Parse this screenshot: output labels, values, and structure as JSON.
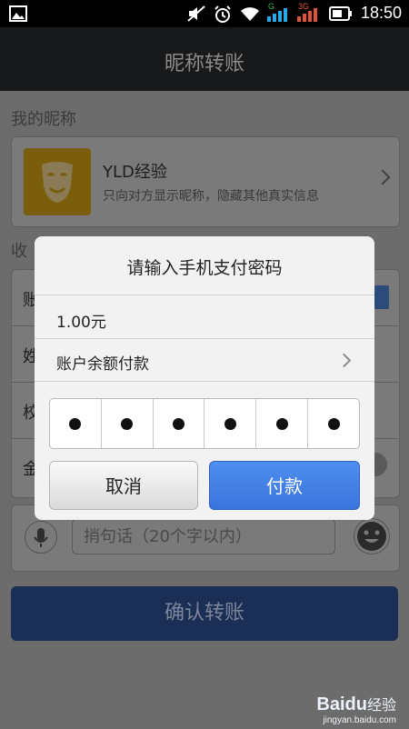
{
  "status_bar": {
    "time": "18:50",
    "network_label_1": "G",
    "network_label_2": "3G"
  },
  "header": {
    "title": "昵称转账"
  },
  "nickname_section": {
    "label": "我的昵称",
    "name": "YLD经验",
    "subtitle": "只向对方显示昵称，隐藏其他真实信息"
  },
  "payee_section": {
    "label_clip": "收",
    "row_labels": [
      "账",
      "姓",
      "校",
      "金"
    ]
  },
  "remark": {
    "placeholder": "捎句话（20个字以内）"
  },
  "confirm_button": "确认转账",
  "dialog": {
    "title": "请输入手机支付密码",
    "amount": "1.00元",
    "pay_method": "账户余额付款",
    "pin_digits_filled": 6,
    "cancel": "取消",
    "pay": "付款"
  },
  "watermark": {
    "brand": "Baidu",
    "suffix": "经验",
    "url": "jingyan.baidu.com"
  },
  "colors": {
    "accent_blue": "#3a74dc",
    "dim_overlay": "#6c6c6c",
    "avatar_gold": "#e8b417"
  }
}
